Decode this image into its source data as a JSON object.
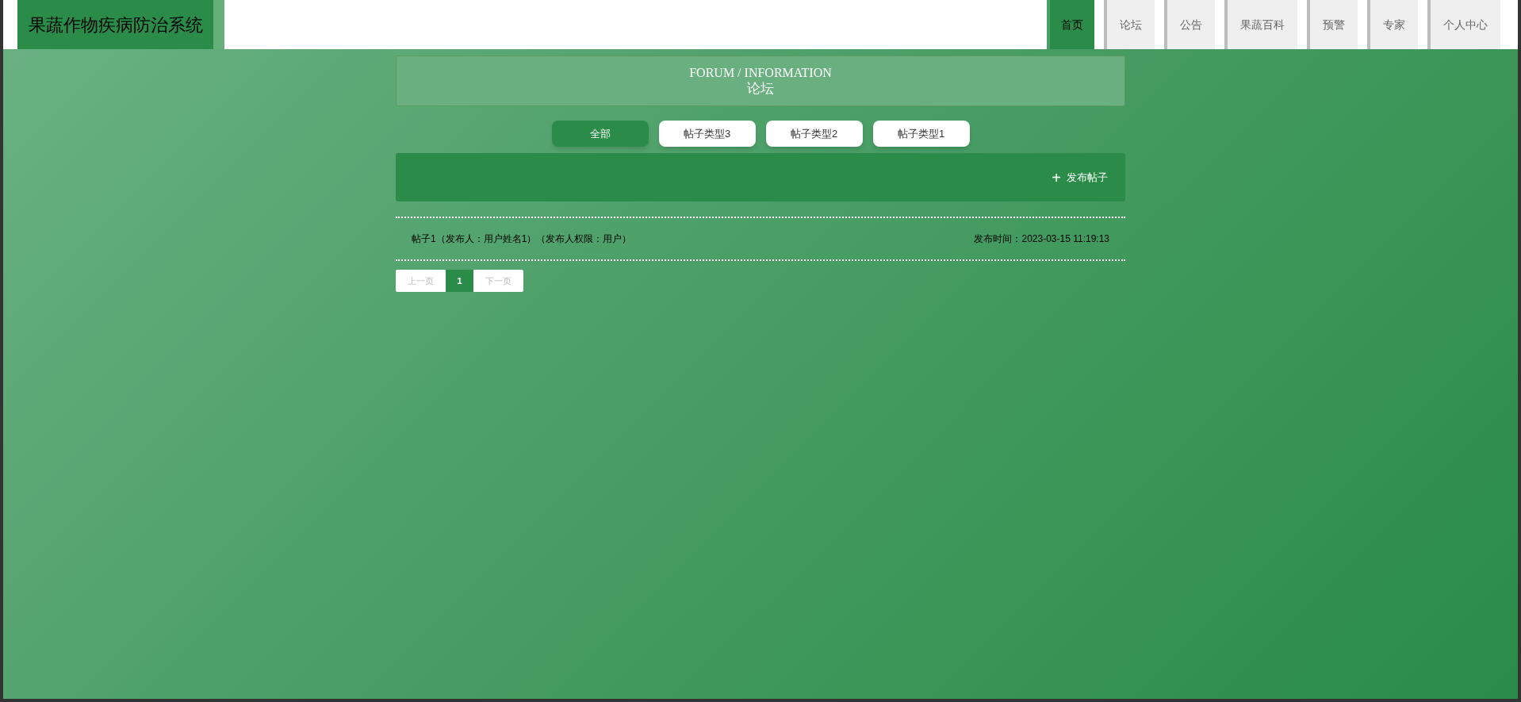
{
  "site_title": "果蔬作物疾病防治系统",
  "nav": [
    {
      "label": "首页",
      "selected": true
    },
    {
      "label": "论坛",
      "selected": false
    },
    {
      "label": "公告",
      "selected": false
    },
    {
      "label": "果蔬百科",
      "selected": false
    },
    {
      "label": "预警",
      "selected": false
    },
    {
      "label": "专家",
      "selected": false
    },
    {
      "label": "个人中心",
      "selected": false
    }
  ],
  "section_heading": {
    "english": "FORUM / INFORMATION",
    "chinese": "论坛"
  },
  "filters": [
    {
      "label": "全部",
      "selected": true
    },
    {
      "label": "帖子类型3",
      "selected": false
    },
    {
      "label": "帖子类型2",
      "selected": false
    },
    {
      "label": "帖子类型1",
      "selected": false
    }
  ],
  "publish_button": {
    "icon": "+",
    "label": "发布帖子"
  },
  "posts": [
    {
      "title": "帖子1（发布人：用户姓名1）（发布人权限：用户）",
      "time": "发布时间：2023-03-15 11:19:13"
    }
  ],
  "pagination": {
    "prev": "上一页",
    "pages": [
      {
        "label": "1",
        "selected": true
      }
    ],
    "next": "下一页"
  }
}
